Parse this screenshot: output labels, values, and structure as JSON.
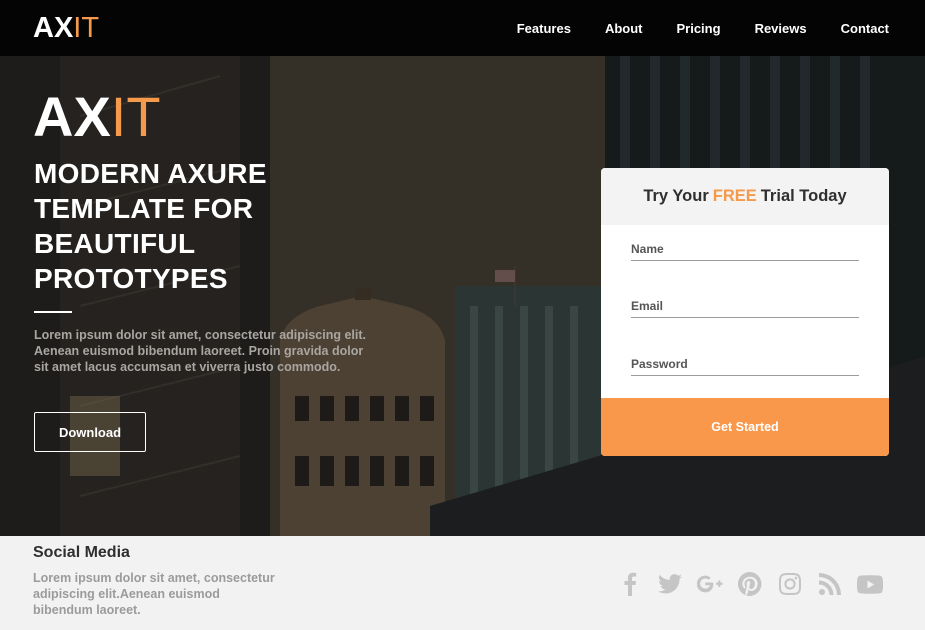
{
  "brand": {
    "logo_part1": "AX",
    "logo_part2": "IT"
  },
  "nav": {
    "items": [
      "Features",
      "About",
      "Pricing",
      "Reviews",
      "Contact"
    ]
  },
  "hero": {
    "logo_part1": "AX",
    "logo_part2": "IT",
    "headline": "MODERN AXURE TEMPLATE FOR BEAUTIFUL PROTOTYPES",
    "description": "Lorem ipsum dolor sit amet, consectetur adipiscing elit. Aenean euismod bibendum laoreet. Proin gravida dolor sit amet lacus accumsan et viverra justo commodo.",
    "download_label": "Download"
  },
  "trial_form": {
    "title_before": "Try Your",
    "title_highlight": "FREE",
    "title_after": "Trial Today",
    "name_placeholder": "Name",
    "email_placeholder": "Email",
    "password_placeholder": "Password",
    "submit_label": "Get Started"
  },
  "footer": {
    "title": "Social Media",
    "description": "Lorem ipsum dolor sit amet, consectetur adipiscing elit.Aenean euismod bibendum laoreet.",
    "social_icons": [
      "facebook-icon",
      "twitter-icon",
      "google-plus-icon",
      "pinterest-icon",
      "instagram-icon",
      "rss-icon",
      "youtube-icon"
    ]
  },
  "colors": {
    "accent": "#f59a4a",
    "button": "#f9984b",
    "nav_bg": "#040404",
    "footer_bg": "#f2f2f2"
  }
}
